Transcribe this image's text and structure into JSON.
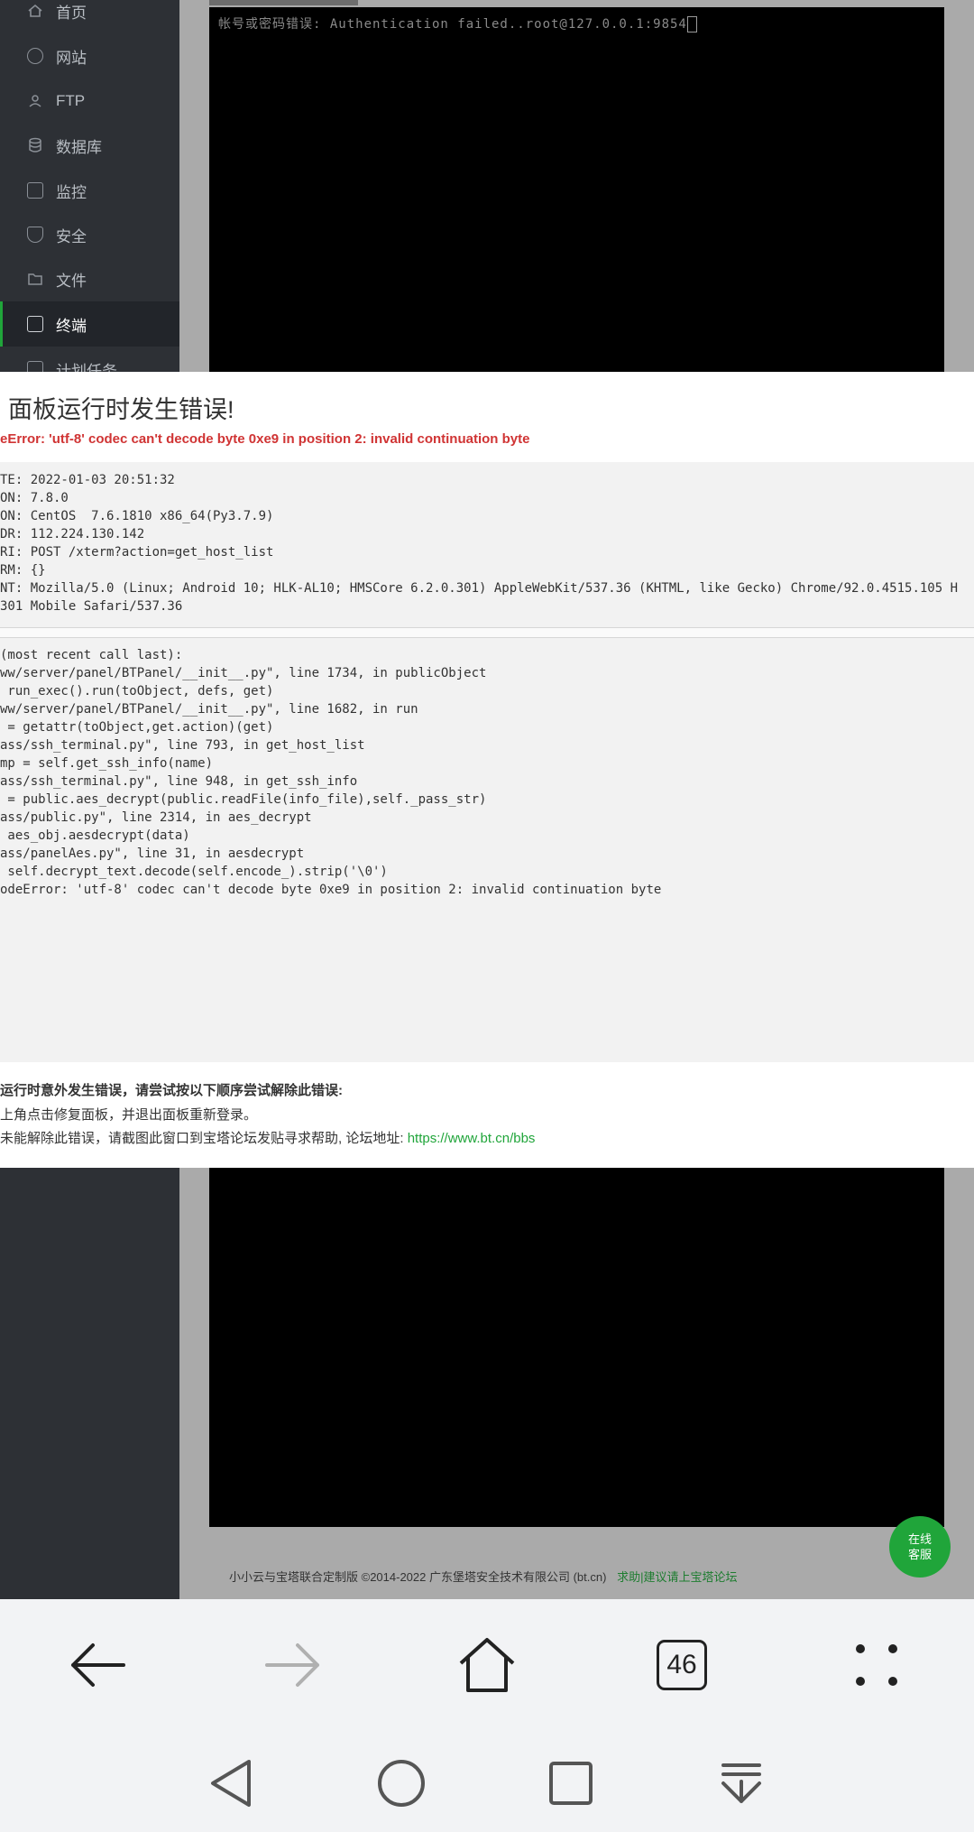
{
  "sidebar": {
    "items": [
      {
        "label": "首页",
        "icon": "home-icon"
      },
      {
        "label": "网站",
        "icon": "globe-icon"
      },
      {
        "label": "FTP",
        "icon": "ftp-icon"
      },
      {
        "label": "数据库",
        "icon": "database-icon"
      },
      {
        "label": "监控",
        "icon": "monitor-icon"
      },
      {
        "label": "安全",
        "icon": "shield-icon"
      },
      {
        "label": "文件",
        "icon": "folder-icon"
      },
      {
        "label": "终端",
        "icon": "terminal-icon",
        "active": true
      },
      {
        "label": "计划任务",
        "icon": "calendar-icon"
      }
    ]
  },
  "terminal": {
    "output": "帐号或密码错误: Authentication failed..root@127.0.0.1:9854"
  },
  "dialog": {
    "title": "面板运行时发生错误!",
    "error_message": "eError: 'utf-8' codec can't decode byte 0xe9 in position 2: invalid continuation byte",
    "info_lines": [
      "TE: 2022-01-03 20:51:32",
      "ON: 7.8.0",
      "ON: CentOS  7.6.1810 x86_64(Py3.7.9)",
      "DR: 112.224.130.142",
      "RI: POST /xterm?action=get_host_list",
      "RM: {}",
      "NT: Mozilla/5.0 (Linux; Android 10; HLK-AL10; HMSCore 6.2.0.301) AppleWebKit/537.36 (KHTML, like Gecko) Chrome/92.0.4515.105 H",
      "301 Mobile Safari/537.36"
    ],
    "trace_lines": [
      "(most recent call last):",
      "ww/server/panel/BTPanel/__init__.py\", line 1734, in publicObject",
      " run_exec().run(toObject, defs, get)",
      "ww/server/panel/BTPanel/__init__.py\", line 1682, in run",
      " = getattr(toObject,get.action)(get)",
      "ass/ssh_terminal.py\", line 793, in get_host_list",
      "mp = self.get_ssh_info(name)",
      "ass/ssh_terminal.py\", line 948, in get_ssh_info",
      " = public.aes_decrypt(public.readFile(info_file),self._pass_str)",
      "ass/public.py\", line 2314, in aes_decrypt",
      " aes_obj.aesdecrypt(data)",
      "ass/panelAes.py\", line 31, in aesdecrypt",
      " self.decrypt_text.decode(self.encode_).strip('\\0')",
      "odeError: 'utf-8' codec can't decode byte 0xe9 in position 2: invalid continuation byte"
    ],
    "help_title": "运行时意外发生错误，请尝试按以下顺序尝试解除此错误:",
    "help_line1": "上角点击修复面板，并退出面板重新登录。",
    "help_line2": "未能解除此错误，请截图此窗口到宝塔论坛发贴寻求帮助, 论坛地址: ",
    "help_link": "https://www.bt.cn/bbs"
  },
  "footer": {
    "copyright": "小小云与宝塔联合定制版 ©2014-2022 广东堡塔安全技术有限公司 (bt.cn)",
    "link": "求助|建议请上宝塔论坛"
  },
  "chat": {
    "line1": "在线",
    "line2": "客服"
  },
  "browser": {
    "tab_count": "46"
  }
}
